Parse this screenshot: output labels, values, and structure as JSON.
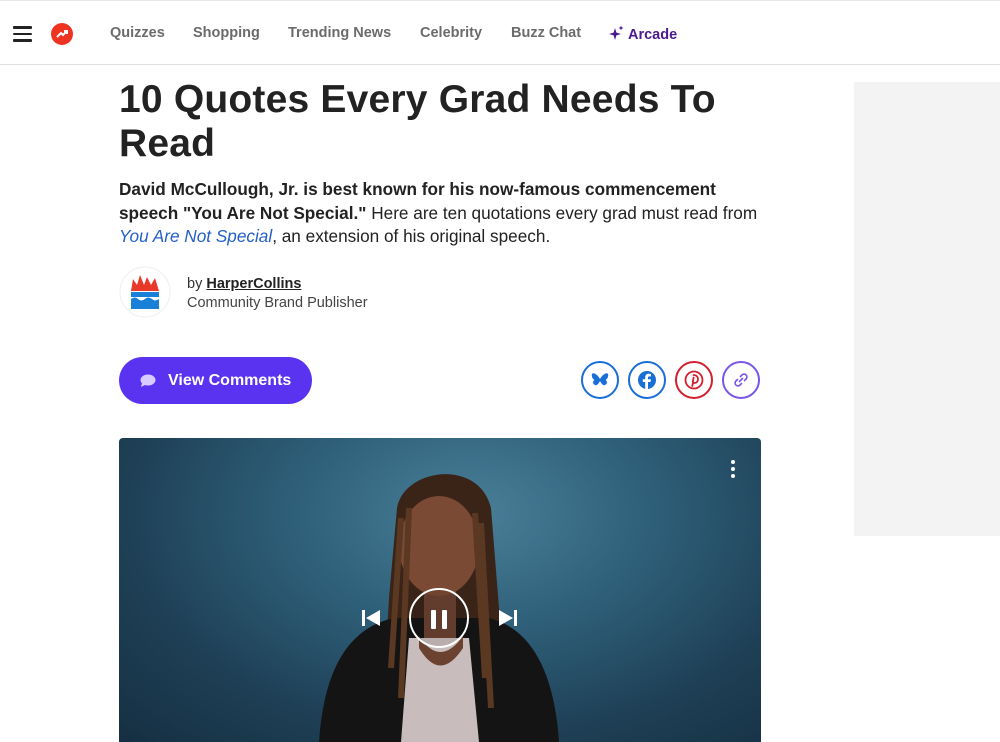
{
  "nav": {
    "links": [
      "Quizzes",
      "Shopping",
      "Trending News",
      "Celebrity",
      "Buzz Chat"
    ],
    "arcade_label": "Arcade",
    "colors": {
      "logo": "#ee3322",
      "arcade": "#4b1a8c"
    }
  },
  "article": {
    "title": "10 Quotes Every Grad Needs To Read",
    "dek_bold": "David McCullough, Jr. is best known for his now-famous commencement speech \"You Are Not Special.\"",
    "dek_plain_1": " Here are ten quotations every grad must read from ",
    "dek_link": "You Are Not Special",
    "dek_plain_2": ", an extension of his original speech.",
    "byline_prefix": "by",
    "author": "HarperCollins",
    "author_role": "Community Brand Publisher"
  },
  "actions": {
    "comments_label": "View Comments",
    "share_icons": [
      "bluesky-icon",
      "facebook-icon",
      "pinterest-icon",
      "link-icon"
    ]
  },
  "video": {
    "controls": [
      "previous-track-icon",
      "pause-icon",
      "next-track-icon"
    ]
  }
}
